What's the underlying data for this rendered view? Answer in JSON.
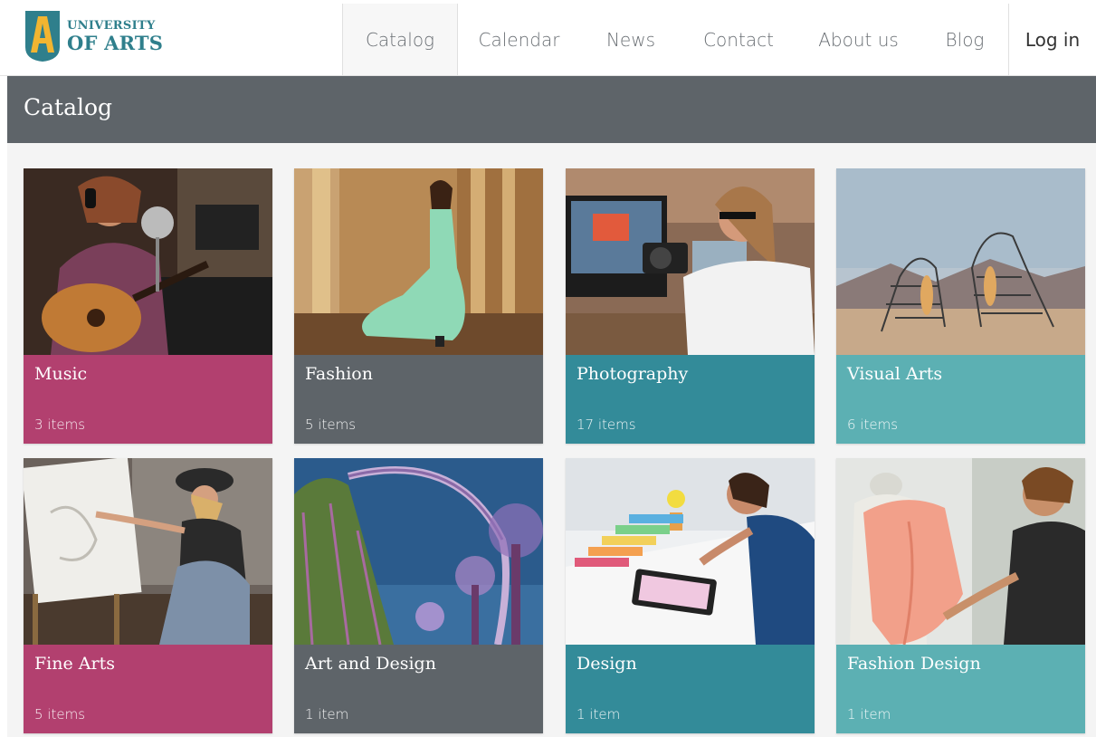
{
  "brand": {
    "line1": "UNIVERSITY",
    "line2": "OF ARTS",
    "icon": "letter-a-shield-logo"
  },
  "nav": {
    "items": [
      {
        "label": "Catalog",
        "active": true
      },
      {
        "label": "Calendar",
        "active": false
      },
      {
        "label": "News",
        "active": false
      },
      {
        "label": "Contact",
        "active": false
      },
      {
        "label": "About us",
        "active": false
      },
      {
        "label": "Blog",
        "active": false
      }
    ],
    "login_label": "Log in"
  },
  "page": {
    "title": "Catalog"
  },
  "colors": {
    "magenta": "#b2406f",
    "slate": "#5e6469",
    "teal_dark": "#338b99",
    "teal_light": "#5cb0b3",
    "brand_teal": "#2f7f8c",
    "brand_yellow": "#f2b531"
  },
  "catalog": [
    {
      "name": "Music",
      "count": "3 items",
      "color": "#b2406f",
      "image": "woman-singing-with-guitar-photo"
    },
    {
      "name": "Fashion",
      "count": "5 items",
      "color": "#5e6469",
      "image": "woman-in-green-dress-photo"
    },
    {
      "name": "Photography",
      "count": "17 items",
      "color": "#338b99",
      "image": "woman-with-camera-photo"
    },
    {
      "name": "Visual Arts",
      "count": "6 items",
      "color": "#5cb0b3",
      "image": "wire-sculpture-desert-photo"
    },
    {
      "name": "Fine Arts",
      "count": "5 items",
      "color": "#b2406f",
      "image": "woman-painting-canvas-photo"
    },
    {
      "name": "Art and Design",
      "count": "1 item",
      "color": "#5e6469",
      "image": "supertree-garden-night-photo"
    },
    {
      "name": "Design",
      "count": "1 item",
      "color": "#338b99",
      "image": "designer-color-swatches-photo"
    },
    {
      "name": "Fashion Design",
      "count": "1 item",
      "color": "#5cb0b3",
      "image": "tailor-with-mannequin-photo"
    }
  ]
}
